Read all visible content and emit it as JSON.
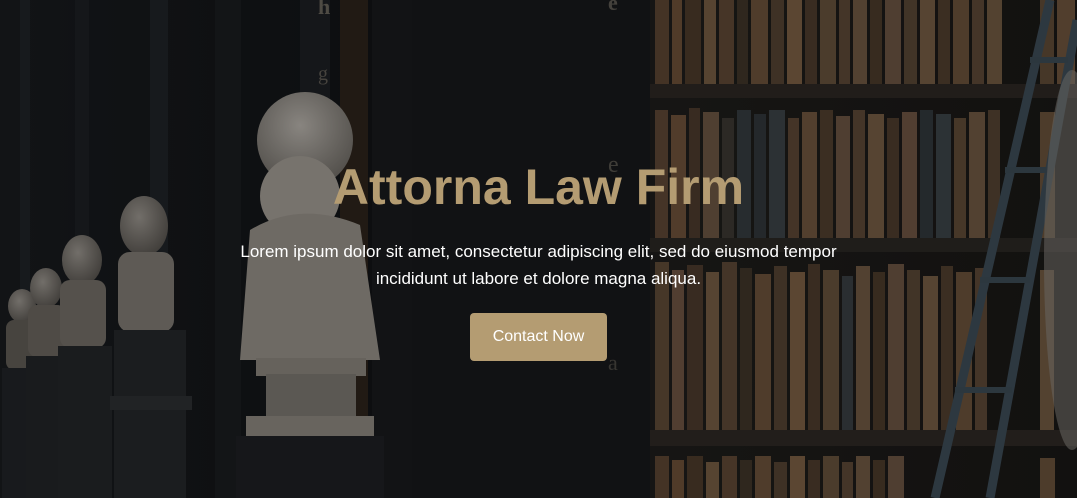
{
  "hero": {
    "title": "Attorna Law Firm",
    "text": "Lorem ipsum dolor sit amet, consectetur adipiscing elit, sed do eiusmod tempor incididunt ut labore et dolore magna aliqua.",
    "button_label": "Contact Now",
    "background_image": "library-with-busts-and-bookshelves"
  },
  "colors": {
    "accent": "#b49c72",
    "text": "#ffffff",
    "background": "#121316"
  }
}
